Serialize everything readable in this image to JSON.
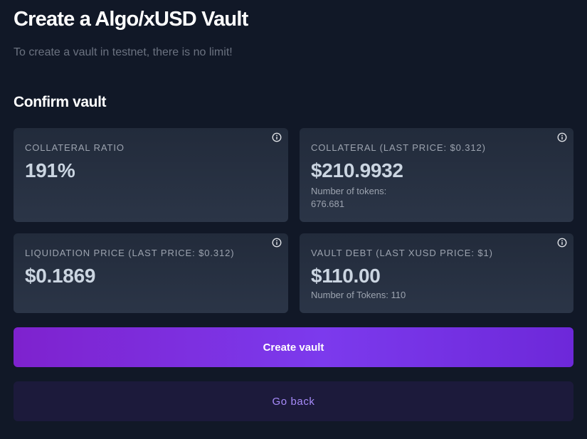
{
  "header": {
    "title": "Create a Algo/xUSD Vault",
    "subtitle": "To create a vault in testnet, there is no limit!"
  },
  "confirm": {
    "section_title": "Confirm vault",
    "cards": {
      "collateral_ratio": {
        "label": "COLLATERAL RATIO",
        "value": "191%",
        "icon": "info-icon"
      },
      "collateral": {
        "label": "COLLATERAL (LAST PRICE: $0.312)",
        "value": "$210.9932",
        "sub_label": "Number of tokens:",
        "sub_value": "676.681",
        "icon": "info-icon"
      },
      "liquidation_price": {
        "label": "LIQUIDATION PRICE (LAST PRICE: $0.312)",
        "value": "$0.1869",
        "icon": "info-icon"
      },
      "vault_debt": {
        "label": "VAULT DEBT (LAST XUSD PRICE: $1)",
        "value": "$110.00",
        "sub_label": "Number of Tokens: 110",
        "icon": "info-icon"
      }
    }
  },
  "actions": {
    "create_label": "Create vault",
    "back_label": "Go back"
  },
  "colors": {
    "background": "#111827",
    "card": "#252e3f",
    "accent": "#7c3aed",
    "secondary_button": "#1c1a3b",
    "secondary_text": "#a78bfa"
  }
}
